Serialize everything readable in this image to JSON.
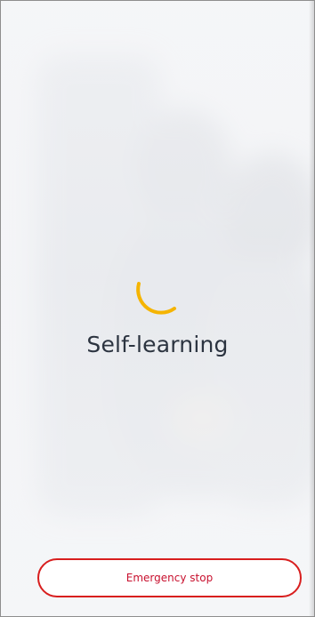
{
  "status": {
    "label": "Self-learning",
    "spinner_color": "#f5b400"
  },
  "actions": {
    "emergency_stop_label": "Emergency stop",
    "emergency_stop_color": "#d81e1e"
  }
}
